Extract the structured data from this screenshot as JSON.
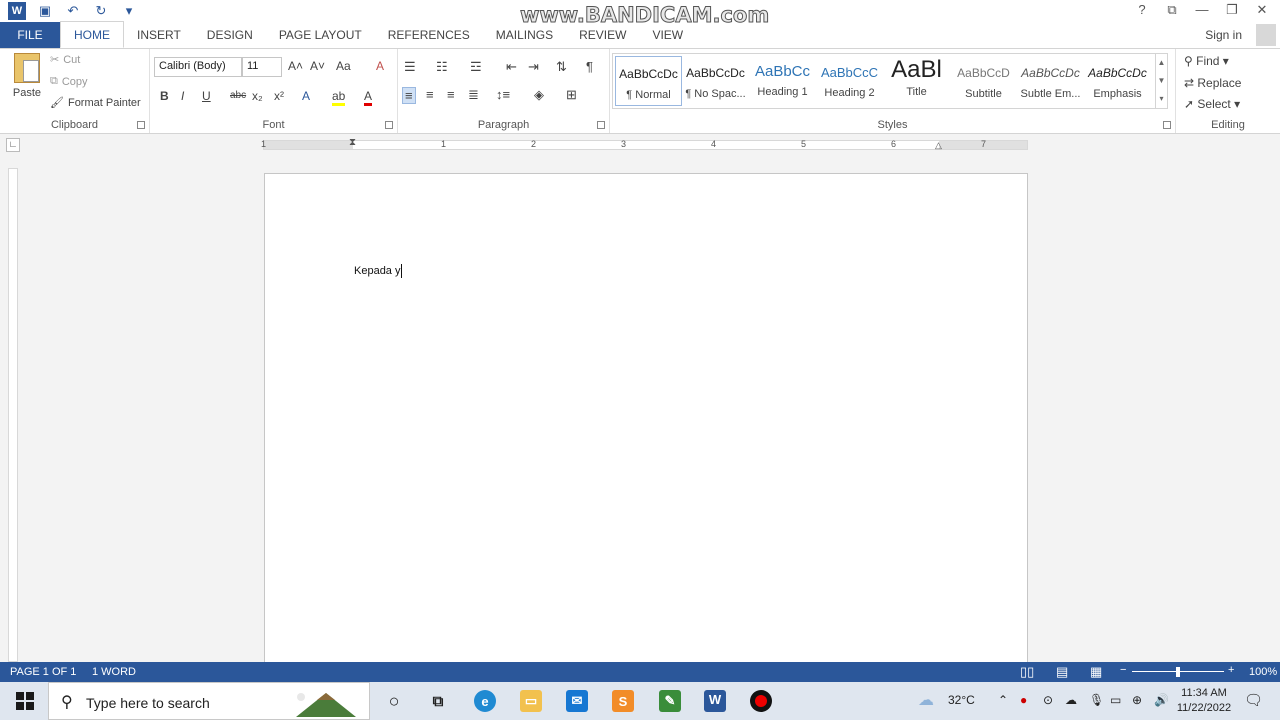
{
  "watermark": "www.BANDICAM.com",
  "window": {
    "help": "?",
    "minimize": "—",
    "restore": "❐",
    "close": "✕"
  },
  "tabs": [
    "FILE",
    "HOME",
    "INSERT",
    "DESIGN",
    "PAGE LAYOUT",
    "REFERENCES",
    "MAILINGS",
    "REVIEW",
    "VIEW"
  ],
  "signin": "Sign in",
  "clipboard": {
    "label": "Clipboard",
    "paste": "Paste",
    "cut": "Cut",
    "copy": "Copy",
    "format_painter": "Format Painter"
  },
  "font": {
    "label": "Font",
    "family": "Calibri (Body)",
    "size": "11",
    "bold": "B",
    "italic": "I",
    "underline": "U",
    "strikethrough": "abc",
    "subscript": "x₂",
    "superscript": "x²",
    "case": "Aa"
  },
  "paragraph": {
    "label": "Paragraph"
  },
  "styles": {
    "label": "Styles",
    "items": [
      {
        "sample": "AaBbCcDc",
        "name": "¶ Normal"
      },
      {
        "sample": "AaBbCcDc",
        "name": "¶ No Spac..."
      },
      {
        "sample": "AaBbCc",
        "name": "Heading 1"
      },
      {
        "sample": "AaBbCcC",
        "name": "Heading 2"
      },
      {
        "sample": "AaBl",
        "name": "Title"
      },
      {
        "sample": "AaBbCcD",
        "name": "Subtitle"
      },
      {
        "sample": "AaBbCcDc",
        "name": "Subtle Em..."
      },
      {
        "sample": "AaBbCcDc",
        "name": "Emphasis"
      }
    ]
  },
  "editing": {
    "label": "Editing",
    "find": "Find",
    "replace": "Replace",
    "select": "Select"
  },
  "ruler_numbers": [
    "1",
    "1",
    "2",
    "3",
    "4",
    "5",
    "6",
    "7"
  ],
  "document": {
    "text": "Kepada y"
  },
  "status": {
    "page": "PAGE 1 OF 1",
    "words": "1 WORD",
    "zoom": "100%"
  },
  "taskbar": {
    "search_placeholder": "Type here to search",
    "temperature": "32°C",
    "time": "11:34 AM",
    "date": "11/22/2022"
  }
}
